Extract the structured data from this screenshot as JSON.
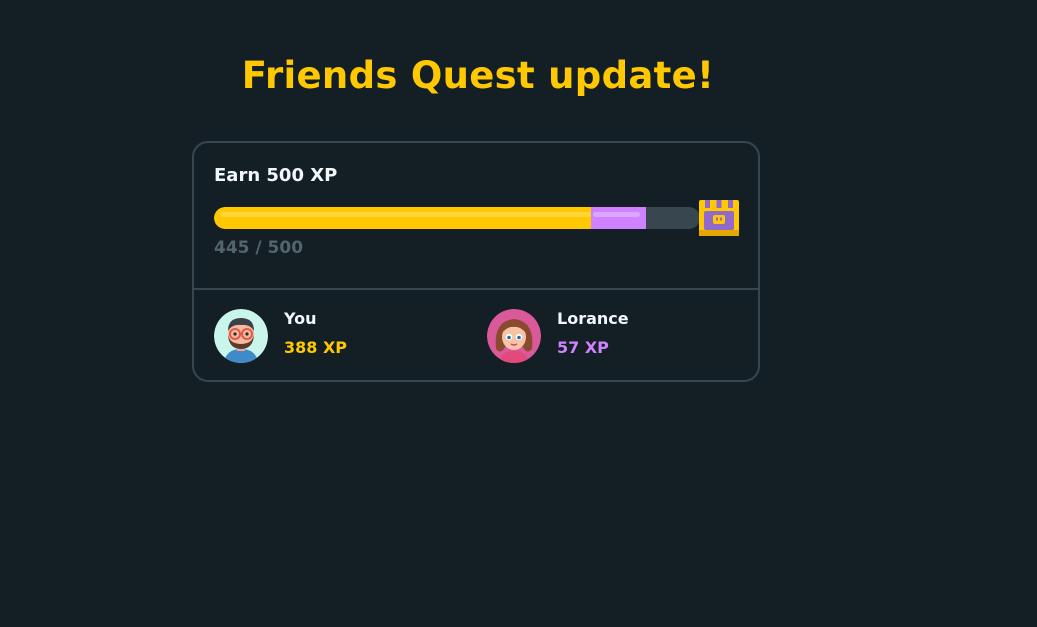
{
  "title": "Friends Quest update!",
  "quest": {
    "goal_label": "Earn 500 XP",
    "progress_text": "445 / 500",
    "current": 445,
    "target": 500,
    "reward_icon": "treasure-chest-icon"
  },
  "members": [
    {
      "name": "You",
      "xp_label": "388 XP",
      "xp": 388,
      "color": "#ffc800"
    },
    {
      "name": "Lorance",
      "xp_label": "57 XP",
      "xp": 57,
      "color": "#ce82ff"
    }
  ],
  "colors": {
    "background": "#131f24",
    "title": "#ffc800",
    "card_border": "#37464f",
    "bar_track": "#37464f",
    "muted_text": "#52656d"
  }
}
